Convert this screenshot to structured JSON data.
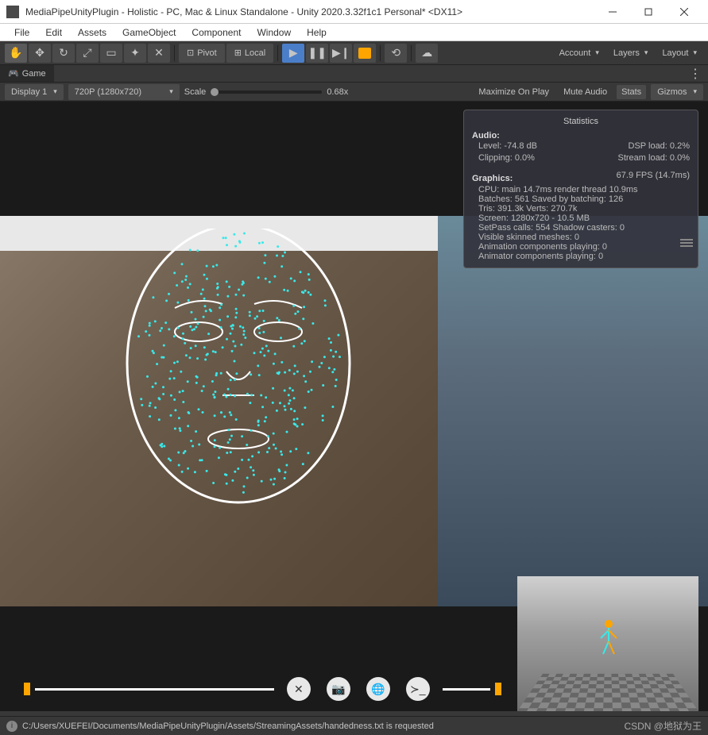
{
  "window": {
    "title": "MediaPipeUnityPlugin - Holistic - PC, Mac & Linux Standalone - Unity 2020.3.32f1c1 Personal* <DX11>"
  },
  "menu": {
    "file": "File",
    "edit": "Edit",
    "assets": "Assets",
    "gameObject": "GameObject",
    "component": "Component",
    "window": "Window",
    "help": "Help"
  },
  "toolbar": {
    "pivot": "Pivot",
    "local": "Local",
    "account": "Account",
    "layers": "Layers",
    "layout": "Layout"
  },
  "tabs": {
    "game": "Game"
  },
  "gameControls": {
    "display": "Display 1",
    "resolution": "720P (1280x720)",
    "scaleLabel": "Scale",
    "scaleValue": "0.68x",
    "maximizeOnPlay": "Maximize On Play",
    "muteAudio": "Mute Audio",
    "stats": "Stats",
    "gizmos": "Gizmos"
  },
  "stats": {
    "title": "Statistics",
    "audio": {
      "heading": "Audio:",
      "level": "Level: -74.8 dB",
      "clipping": "Clipping: 0.0%",
      "dspLoad": "DSP load: 0.2%",
      "streamLoad": "Stream load: 0.0%"
    },
    "graphics": {
      "heading": "Graphics:",
      "fps": "67.9 FPS (14.7ms)",
      "cpu": "CPU: main 14.7ms  render thread 10.9ms",
      "batches": "Batches: 561    Saved by batching: 126",
      "tris": "Tris: 391.3k      Verts: 270.7k",
      "screen": "Screen: 1280x720 - 10.5 MB",
      "setpass": "SetPass calls: 554        Shadow casters: 0",
      "skinned": "Visible skinned meshes: 0",
      "animComp": "Animation components playing: 0",
      "animatorComp": "Animator components playing: 0"
    }
  },
  "statusbar": {
    "message": "C:/Users/XUEFEI/Documents/MediaPipeUnityPlugin/Assets/StreamingAssets/handedness.txt is requested"
  },
  "watermark": {
    "text": "CSDN @地狱为王"
  }
}
